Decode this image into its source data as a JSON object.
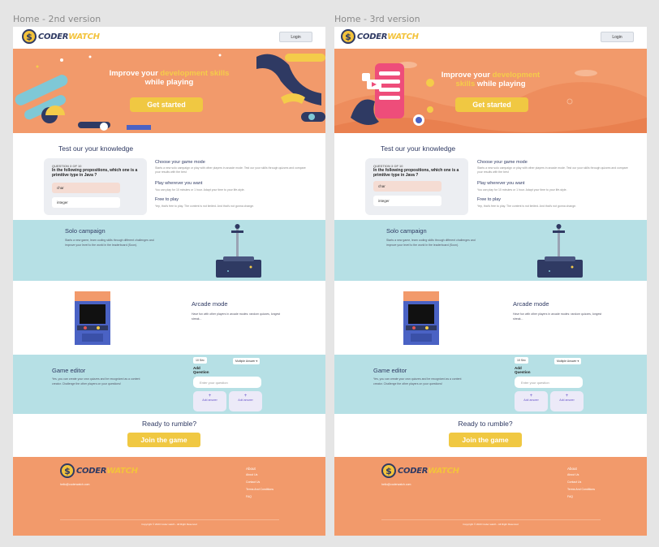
{
  "artboards": [
    {
      "label": "Home - 2nd version",
      "logo": {
        "coin": "$",
        "text_main": "CODER",
        "text_accent": "WATCH"
      },
      "nav": {
        "login": "Login"
      },
      "hero": {
        "line1": "Improve your ",
        "line1_accent": "development skills",
        "line2": "while playing",
        "cta": "Get started"
      },
      "knowledge": {
        "title": "Test our your knowledge",
        "quiz": {
          "progress": "QUESTION 3 OF 10",
          "question": "In the following propositions, which one is a primitive type in Java ?",
          "options": [
            "char",
            "integer"
          ]
        },
        "modes": [
          {
            "title": "Choose your game mode",
            "text": "Starts a new solo campaign or play with other players in arcade mode. Test our your skills through quizzes and compare your results with the best"
          },
          {
            "title": "Play wherever you want",
            "text": "You can play for 10 minutes or 1 hour. Adapt your time to your life-style."
          },
          {
            "title": "Free to play",
            "text": "Yep, that's free to play. The content is not limited. And that's not gonna change."
          }
        ]
      },
      "solo": {
        "title": "Solo campaign",
        "text": "Starts a new game, learn coding skills through different challenges and improve your level to the world in the leaderboard (Soon)."
      },
      "arcade": {
        "title": "Arcade mode",
        "text": "Have fun with other players in arcade modes: random quizzes, longest streak..."
      },
      "editor": {
        "title": "Game editor",
        "text": "Yes, you can create your own quizzes and be recognized as a content creator. Challenge the other players on your questions!",
        "timer": "10 Sec",
        "type": "Multiple Answer",
        "add_question": "Add Question",
        "placeholder": "Enter your question",
        "add_answer": "Add answer"
      },
      "ready": {
        "title": "Ready to rumble?",
        "cta": "Join the game"
      },
      "footer": {
        "email": "hello@coderwatch.com",
        "heading": "About",
        "links": [
          "About Us",
          "Contact Us",
          "Terms And Conditions",
          "FAQ"
        ],
        "copyright": "Copyright © 2023 Coder watch - All Right Reserved"
      }
    },
    {
      "label": "Home - 3rd version",
      "logo": {
        "coin": "$",
        "text_main": "CODER",
        "text_accent": "WATCH"
      },
      "nav": {
        "login": "Login"
      },
      "hero": {
        "line1": "Improve your ",
        "line1_accent": "development skills",
        "line2": "while playing",
        "cta": "Get started"
      },
      "knowledge": {
        "title": "Test our your knowledge",
        "quiz": {
          "progress": "QUESTION 3 OF 10",
          "question": "In the following propositions, which one is a primitive type in Java ?",
          "options": [
            "char",
            "integer"
          ]
        },
        "modes": [
          {
            "title": "Choose your game mode",
            "text": "Starts a new solo campaign or play with other players in arcade mode. Test our your skills through quizzes and compare your results with the best"
          },
          {
            "title": "Play wherever you want",
            "text": "You can play for 10 minutes or 1 hour. Adapt your time to your life-style."
          },
          {
            "title": "Free to play",
            "text": "Yep, that's free to play. The content is not limited. And that's not gonna change."
          }
        ]
      },
      "solo": {
        "title": "Solo campaign",
        "text": "Starts a new game, learn coding skills through different challenges and improve your level to the world in the leaderboard (Soon)."
      },
      "arcade": {
        "title": "Arcade mode",
        "text": "Have fun with other players in arcade modes: random quizzes, longest streak..."
      },
      "editor": {
        "title": "Game editor",
        "text": "Yes, you can create your own quizzes and be recognized as a content creator. Challenge the other players on your questions!",
        "timer": "10 Sec",
        "type": "Multiple Answer",
        "add_question": "Add Question",
        "placeholder": "Enter your question",
        "add_answer": "Add answer"
      },
      "ready": {
        "title": "Ready to rumble?",
        "cta": "Join the game"
      },
      "footer": {
        "email": "hello@coderwatch.com",
        "heading": "About",
        "links": [
          "About Us",
          "Contact Us",
          "Terms And Conditions",
          "FAQ"
        ],
        "copyright": "Copyright © 2023 Coder watch - All Right Reserved"
      }
    }
  ],
  "colors": {
    "accent_orange": "#f29a6b",
    "accent_yellow": "#f0c842",
    "navy": "#2f3a63",
    "band_blue": "#b6e0e5"
  }
}
